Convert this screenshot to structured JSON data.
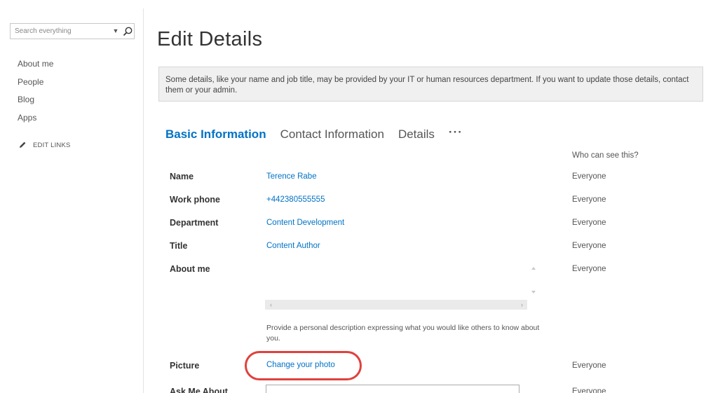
{
  "search": {
    "placeholder": "Search everything",
    "dropdown_glyph": "▼"
  },
  "nav": {
    "items": [
      {
        "label": "About me"
      },
      {
        "label": "People"
      },
      {
        "label": "Blog"
      },
      {
        "label": "Apps"
      }
    ],
    "edit_links_label": "EDIT LINKS"
  },
  "page": {
    "title": "Edit Details",
    "banner": "Some details, like your name and job title, may be provided by your IT or human resources department. If you want to update those details, contact them or your admin."
  },
  "tabs": [
    {
      "label": "Basic Information",
      "active": true
    },
    {
      "label": "Contact Information",
      "active": false
    },
    {
      "label": "Details",
      "active": false
    }
  ],
  "tabs_more": "···",
  "visibility_header": "Who can see this?",
  "fields": {
    "name": {
      "label": "Name",
      "value": "Terence Rabe",
      "visibility": "Everyone"
    },
    "work_phone": {
      "label": "Work phone",
      "value": "+442380555555",
      "visibility": "Everyone"
    },
    "department": {
      "label": "Department",
      "value": "Content Development",
      "visibility": "Everyone"
    },
    "title": {
      "label": "Title",
      "value": "Content Author",
      "visibility": "Everyone"
    },
    "about_me": {
      "label": "About me",
      "value": "",
      "visibility": "Everyone",
      "hint": "Provide a personal description expressing what you would like others to know about you."
    },
    "picture": {
      "label": "Picture",
      "link": "Change your photo",
      "visibility": "Everyone"
    },
    "ask_me_about": {
      "label": "Ask Me About",
      "visibility": "Everyone"
    }
  },
  "colors": {
    "accent": "#0072c6",
    "highlight": "#e0413c",
    "banner_bg": "#f0f0f0"
  }
}
